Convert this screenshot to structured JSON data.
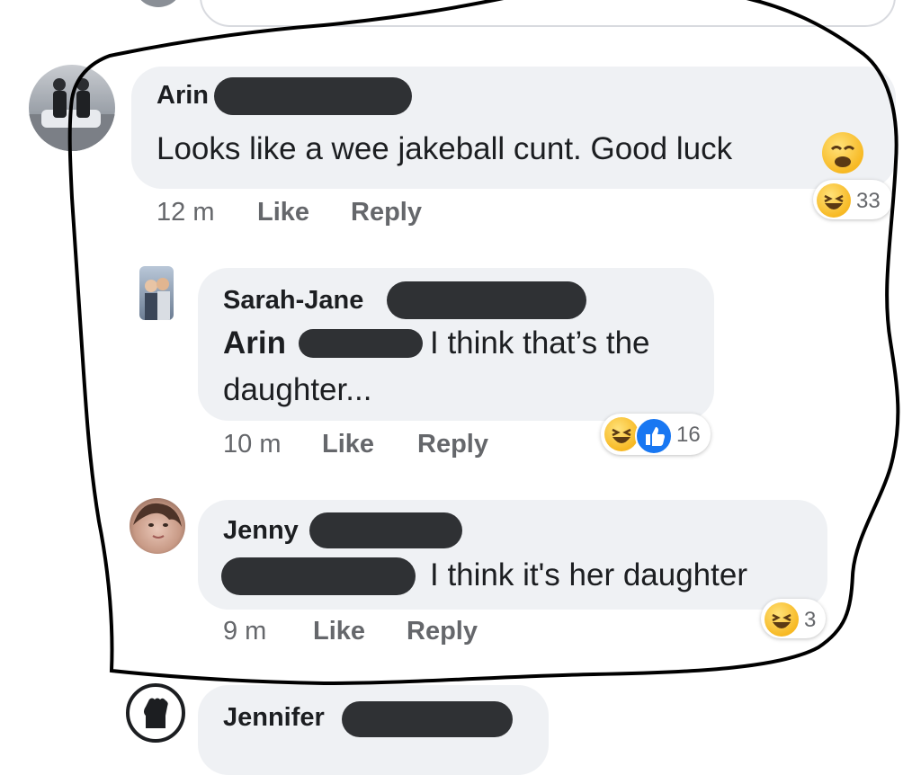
{
  "comments": [
    {
      "author": "Arin",
      "text": "Looks like a wee jakeball cunt. Good luck",
      "time": "12 m",
      "like_label": "Like",
      "reply_label": "Reply",
      "reaction_count": "33",
      "text_emoji": "weary-face-icon",
      "reaction_icons": [
        "laugh-reaction-icon"
      ]
    },
    {
      "author": "Sarah-Jane",
      "mention": "Arin",
      "text_line1": "I think that’s the",
      "text_line2": "daughter...",
      "time": "10 m",
      "like_label": "Like",
      "reply_label": "Reply",
      "reaction_count": "16",
      "reaction_icons": [
        "laugh-reaction-icon",
        "like-reaction-icon"
      ]
    },
    {
      "author": "Jenny",
      "text": "I think it's her daughter",
      "time": "9 m",
      "like_label": "Like",
      "reply_label": "Reply",
      "reaction_count": "3",
      "reaction_icons": [
        "laugh-reaction-icon"
      ]
    },
    {
      "author": "Jennifer"
    }
  ],
  "colors": {
    "bubble": "#eff1f4",
    "redaction": "#2f3134",
    "meta_text": "#65676b",
    "like_blue": "#1877f2",
    "marker_ink": "#000000"
  }
}
